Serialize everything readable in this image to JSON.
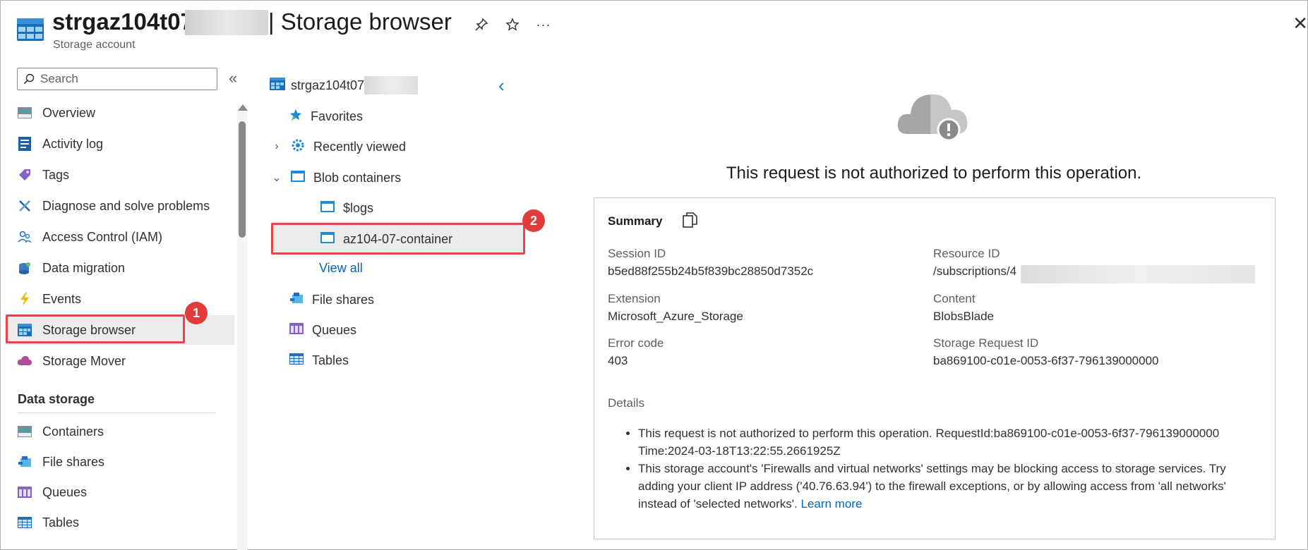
{
  "header": {
    "title_prefix": "strgaz104t07",
    "title_suffix": "| Storage browser",
    "subtitle": "Storage account",
    "pin_icon": "pin-icon",
    "favorite_icon": "star-icon",
    "more_icon": "ellipsis-icon"
  },
  "nav": {
    "search_placeholder": "Search",
    "items": [
      {
        "label": "Overview",
        "icon": "overview-icon"
      },
      {
        "label": "Activity log",
        "icon": "activity-log-icon"
      },
      {
        "label": "Tags",
        "icon": "tag-icon"
      },
      {
        "label": "Diagnose and solve problems",
        "icon": "wrench-icon"
      },
      {
        "label": "Access Control (IAM)",
        "icon": "people-icon"
      },
      {
        "label": "Data migration",
        "icon": "data-migration-icon"
      },
      {
        "label": "Events",
        "icon": "lightning-icon"
      },
      {
        "label": "Storage browser",
        "icon": "storage-browser-icon"
      },
      {
        "label": "Storage Mover",
        "icon": "cloud-mover-icon"
      }
    ],
    "section_title": "Data storage",
    "section_items": [
      {
        "label": "Containers",
        "icon": "containers-icon"
      },
      {
        "label": "File shares",
        "icon": "file-shares-icon"
      },
      {
        "label": "Queues",
        "icon": "queues-icon"
      },
      {
        "label": "Tables",
        "icon": "tables-icon"
      }
    ]
  },
  "tree": {
    "root": "strgaz104t07",
    "favorites": "Favorites",
    "recently_viewed": "Recently viewed",
    "blob_containers": "Blob containers",
    "containers": [
      "$logs",
      "az104-07-container"
    ],
    "view_all": "View all",
    "file_shares": "File shares",
    "queues": "Queues",
    "tables": "Tables"
  },
  "callouts": {
    "one": "1",
    "two": "2"
  },
  "error": {
    "title": "This request is not authorized to perform this operation.",
    "summary_title": "Summary",
    "fields": {
      "session_id_label": "Session ID",
      "session_id": "b5ed88f255b24b5f839bc28850d7352c",
      "resource_id_label": "Resource ID",
      "resource_id": "/subscriptions/4",
      "extension_label": "Extension",
      "extension": "Microsoft_Azure_Storage",
      "content_label": "Content",
      "content": "BlobsBlade",
      "error_code_label": "Error code",
      "error_code": "403",
      "storage_request_id_label": "Storage Request ID",
      "storage_request_id": "ba869100-c01e-0053-6f37-796139000000"
    },
    "details_label": "Details",
    "detail_1": "This request is not authorized to perform this operation. RequestId:ba869100-c01e-0053-6f37-796139000000 Time:2024-03-18T13:22:55.2661925Z",
    "detail_2": "This storage account's 'Firewalls and virtual networks' settings may be blocking access to storage services. Try adding your client IP address ('40.76.63.94') to the firewall exceptions, or by allowing access from 'all networks' instead of 'selected networks'.",
    "learn_more": "Learn more"
  },
  "colors": {
    "accent": "#0078d4",
    "callout": "#e34848",
    "link": "#0067b8"
  }
}
